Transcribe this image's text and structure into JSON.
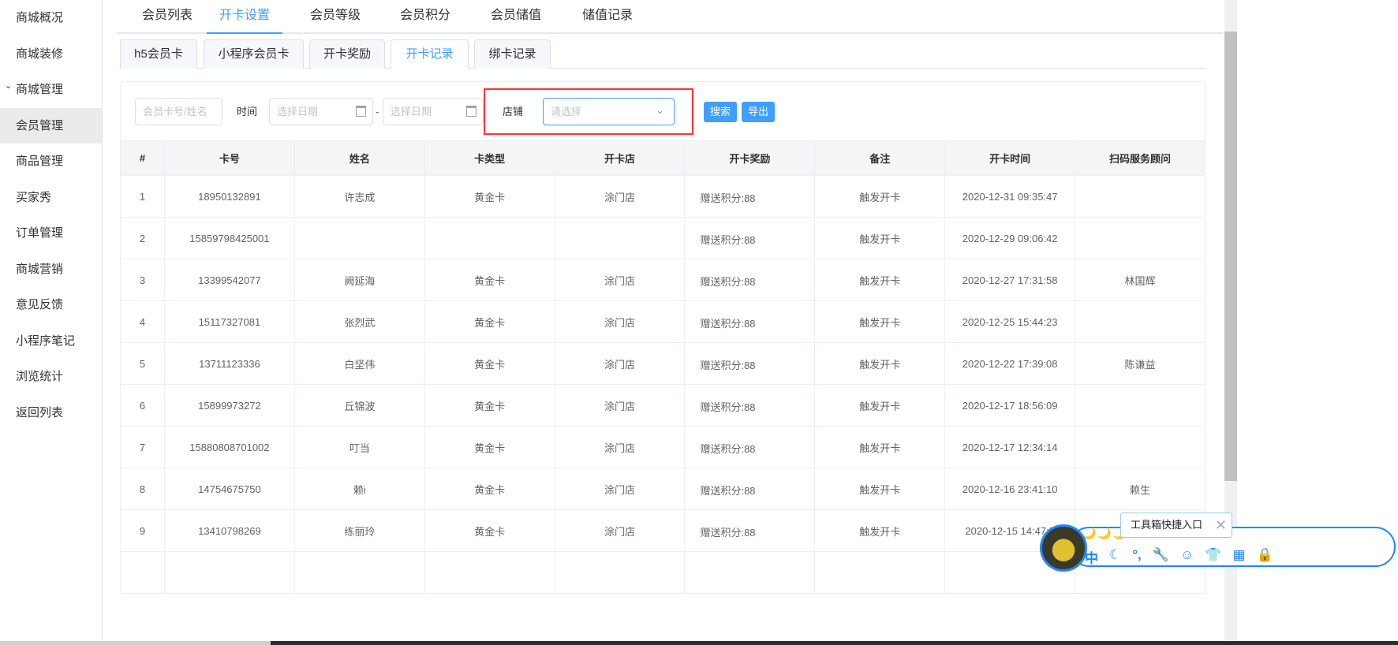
{
  "sidebar": {
    "items": [
      {
        "label": "商城概况"
      },
      {
        "label": "商城装修"
      },
      {
        "label": "商城管理",
        "expanded": true
      },
      {
        "label": "会员管理",
        "active": true
      },
      {
        "label": "商品管理"
      },
      {
        "label": "买家秀"
      },
      {
        "label": "订单管理"
      },
      {
        "label": "商城营销"
      },
      {
        "label": "意见反馈"
      },
      {
        "label": "小程序笔记"
      },
      {
        "label": "浏览统计"
      },
      {
        "label": "返回列表"
      }
    ]
  },
  "top_tabs": [
    "会员列表",
    "开卡设置",
    "会员等级",
    "会员积分",
    "会员储值",
    "储值记录"
  ],
  "active_top_tab": "开卡设置",
  "sub_tabs": [
    "h5会员卡",
    "小程序会员卡",
    "开卡奖励",
    "开卡记录",
    "绑卡记录"
  ],
  "active_sub_tab": "开卡记录",
  "filter": {
    "keyword_placeholder": "会员卡号/姓名",
    "time_label": "时间",
    "start_placeholder": "选择日期",
    "separator": "-",
    "end_placeholder": "选择日期",
    "store_label": "店铺",
    "store_placeholder": "请选择",
    "search_btn": "搜索",
    "export_btn": "导出"
  },
  "table": {
    "headers": [
      "#",
      "卡号",
      "姓名",
      "卡类型",
      "开卡店",
      "开卡奖励",
      "备注",
      "开卡时间",
      "扫码服务顾问"
    ],
    "rows": [
      [
        "1",
        "18950132891",
        "许志成",
        "黄金卡",
        "涂门店",
        "赠送积分:88",
        "触发开卡",
        "2020-12-31 09:35:47",
        ""
      ],
      [
        "2",
        "15859798425001",
        "",
        "",
        "",
        "赠送积分:88",
        "触发开卡",
        "2020-12-29 09:06:42",
        ""
      ],
      [
        "3",
        "13399542077",
        "阙延海",
        "黄金卡",
        "涂门店",
        "赠送积分:88",
        "触发开卡",
        "2020-12-27 17:31:58",
        "林国辉"
      ],
      [
        "4",
        "15117327081",
        "张烈武",
        "黄金卡",
        "涂门店",
        "赠送积分:88",
        "触发开卡",
        "2020-12-25 15:44:23",
        ""
      ],
      [
        "5",
        "13711123336",
        "白坚伟",
        "黄金卡",
        "涂门店",
        "赠送积分:88",
        "触发开卡",
        "2020-12-22 17:39:08",
        "陈谦益"
      ],
      [
        "6",
        "15899973272",
        "丘锦波",
        "黄金卡",
        "涂门店",
        "赠送积分:88",
        "触发开卡",
        "2020-12-17 18:56:09",
        ""
      ],
      [
        "7",
        "15880808701002",
        "叮当",
        "黄金卡",
        "涂门店",
        "赠送积分:88",
        "触发开卡",
        "2020-12-17 12:34:14",
        ""
      ],
      [
        "8",
        "14754675750",
        "赖i",
        "黄金卡",
        "涂门店",
        "赠送积分:88",
        "触发开卡",
        "2020-12-16 23:41:10",
        "赖生"
      ],
      [
        "9",
        "13410798269",
        "练丽玲",
        "黄金卡",
        "涂门店",
        "赠送积分:88",
        "触发开卡",
        "2020-12-15 14:47:5",
        ""
      ],
      [
        "",
        "",
        "",
        "",
        "",
        "",
        "",
        "",
        ""
      ]
    ]
  },
  "widget": {
    "tooltip": "工具箱快捷入口",
    "icons": [
      "中",
      "☾",
      "°,",
      "🔧",
      "☺",
      "👕",
      "▦",
      "🔒"
    ]
  }
}
